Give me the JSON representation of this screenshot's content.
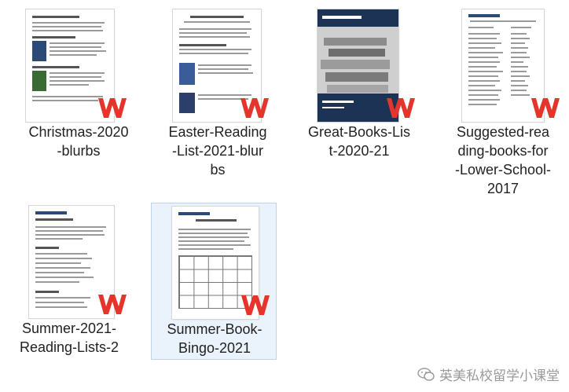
{
  "files": [
    {
      "name": "Christmas-2020-blurbs",
      "lines": [
        "Christmas-2020",
        "-blurbs"
      ]
    },
    {
      "name": "Easter-Reading-List-2021-blurbs",
      "lines": [
        "Easter-Reading",
        "-List-2021-blur",
        "bs"
      ]
    },
    {
      "name": "Great-Books-List-2020-21",
      "lines": [
        "Great-Books-Lis",
        "t-2020-21"
      ]
    },
    {
      "name": "Suggested-reading-books-for-Lower-School-2017",
      "lines": [
        "Suggested-rea",
        "ding-books-for",
        "-Lower-School-",
        "2017"
      ]
    },
    {
      "name": "Summer-2021-Reading-Lists-2",
      "lines": [
        "Summer-2021-",
        "Reading-Lists-2"
      ]
    },
    {
      "name": "Summer-Book-Bingo-2021",
      "lines": [
        "Summer-Book-",
        "Bingo-2021"
      ]
    }
  ],
  "footer": {
    "text": "英美私校留学小课堂",
    "icon": "wechat-icon"
  },
  "colors": {
    "wps_red": "#e5342b",
    "navy": "#1d3355",
    "selection": "#eaf2fb"
  }
}
